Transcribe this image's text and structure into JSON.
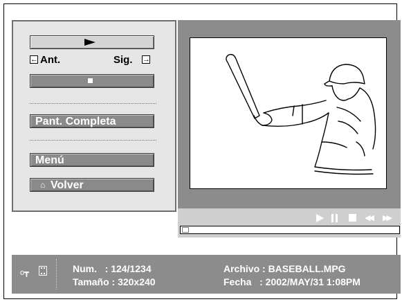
{
  "controls": {
    "prev_label": "Ant.",
    "next_label": "Sig.",
    "prev_arrow": "←",
    "next_arrow": "→",
    "fullscreen_label": "Pant. Completa",
    "menu_label": "Menú",
    "back_label": "Volver",
    "back_icon": "⌂"
  },
  "transport": {
    "rewind_glyph": "◀◀",
    "forward_glyph": "▶▶"
  },
  "info": {
    "num_line": "Num.   : 124/1234",
    "size_line": "Tamaño : 320x240",
    "file_line": "Archivo : BASEBALL.MPG",
    "date_line": "Fecha   : 2002/MAY/31 1:08PM",
    "key_icon": "o┳"
  },
  "playback": {
    "progress": 0.0
  },
  "colors": {
    "panel": "#e6e6e6",
    "button": "#8a8a8a",
    "video_bg": "#8c8c8c",
    "info_bar": "#8c8c8c"
  }
}
